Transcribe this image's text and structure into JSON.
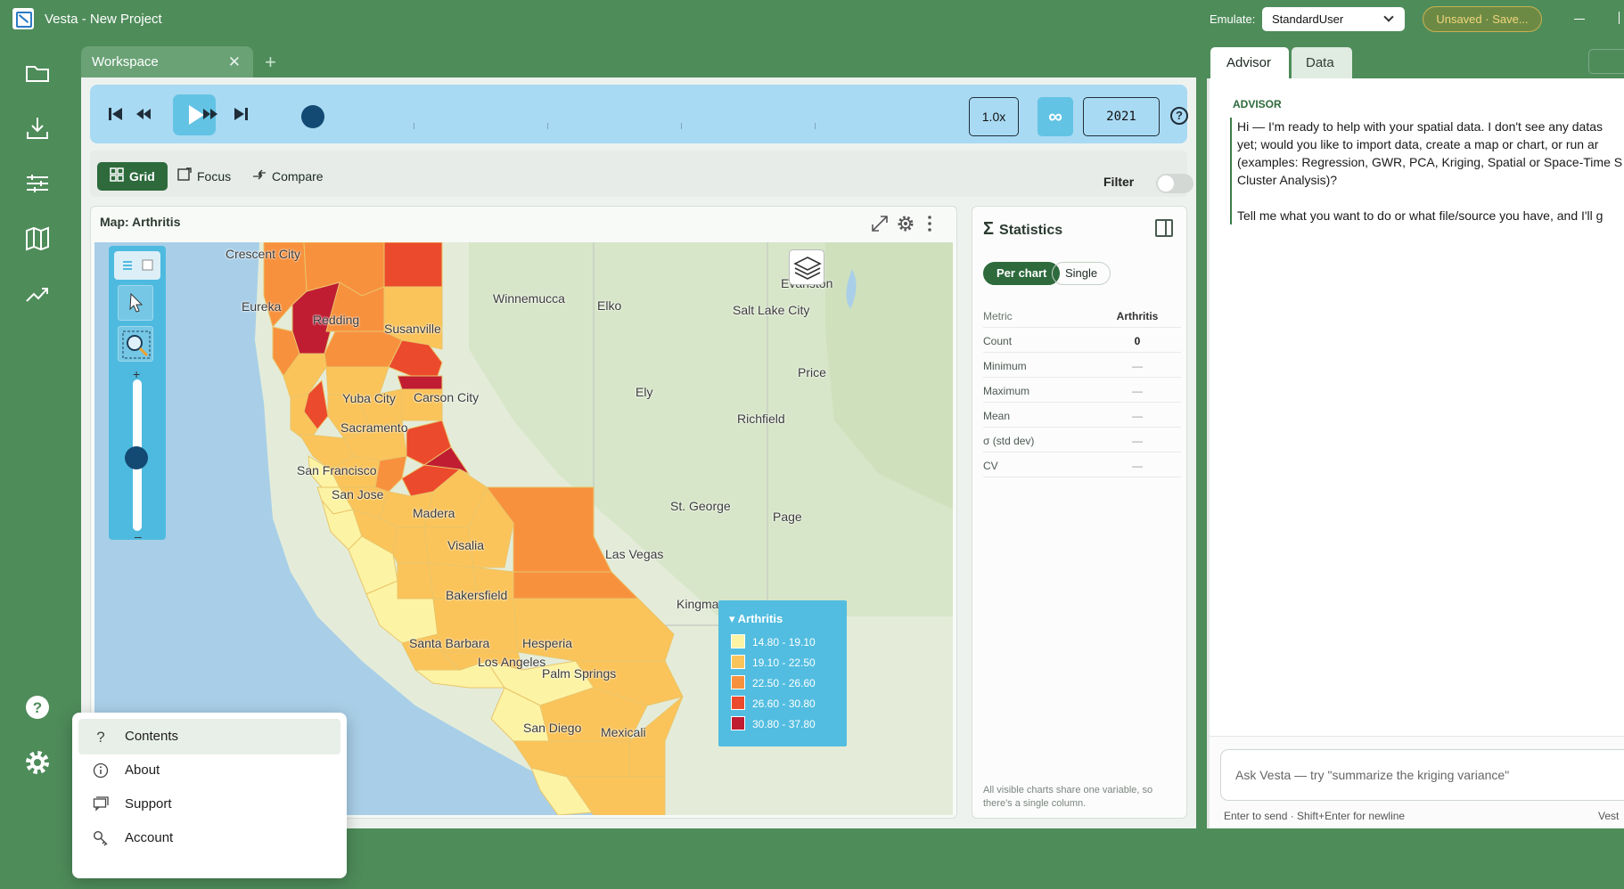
{
  "window": {
    "title": "Vesta - New Project",
    "emulate_label": "Emulate:",
    "emulate_value": "StandardUser",
    "unsaved_label": "Unsaved · Save..."
  },
  "rail": {
    "items": [
      "folder-icon",
      "import-icon",
      "sliders-icon",
      "map-icon",
      "trend-icon"
    ],
    "bottom": [
      "help-icon",
      "settings-icon"
    ]
  },
  "workspace_tab": {
    "label": "Workspace"
  },
  "playbar": {
    "speed": "1.0x",
    "loop_symbol": "∞",
    "year": "2021"
  },
  "viewbar": {
    "grid_label": "Grid",
    "focus_label": "Focus",
    "compare_label": "Compare",
    "filter_label": "Filter"
  },
  "map": {
    "title": "Map: Arthritis",
    "places": [
      "Crescent City",
      "Eureka",
      "Redding",
      "Susanville",
      "Winnemucca",
      "Elko",
      "Salt Lake City",
      "Evanston",
      "Price",
      "Ely",
      "Carson City",
      "Yuba City",
      "Sacramento",
      "Richfield",
      "San Francisco",
      "San Jose",
      "Madera",
      "St. George",
      "Page",
      "Visalia",
      "Las Vegas",
      "Bakersfield",
      "Kingman",
      "Santa Barbara",
      "Hesperia",
      "Los Angeles",
      "Palm Springs",
      "San Diego",
      "Mexicali"
    ],
    "legend": {
      "title": "Arthritis",
      "items": [
        {
          "label": "14.80 - 19.10",
          "color": "#fdf3a4"
        },
        {
          "label": "19.10 - 22.50",
          "color": "#fbc45a"
        },
        {
          "label": "22.50 - 26.60",
          "color": "#f8913e"
        },
        {
          "label": "26.60 - 30.80",
          "color": "#ec4a2c"
        },
        {
          "label": "30.80 - 37.80",
          "color": "#c01d33"
        }
      ]
    }
  },
  "statistics": {
    "title": "Statistics",
    "toggle_per_chart": "Per chart",
    "toggle_single": "Single",
    "column_header": "Arthritis",
    "metric_header": "Metric",
    "rows": [
      {
        "metric": "Count",
        "value": "0"
      },
      {
        "metric": "Minimum",
        "value": "—"
      },
      {
        "metric": "Maximum",
        "value": "—"
      },
      {
        "metric": "Mean",
        "value": "—"
      },
      {
        "metric": "σ (std dev)",
        "value": "—"
      },
      {
        "metric": "CV",
        "value": "—"
      }
    ],
    "footer": "All visible charts share one variable, so there's a single column."
  },
  "advisor": {
    "tabs": [
      "Advisor",
      "Data"
    ],
    "heading": "ADVISOR",
    "message": "Hi — I'm ready to help with your spatial data. I don't see any datas\nyet; would you like to import data, create a map or chart, or run ar\n(examples: Regression, GWR, PCA, Kriging, Spatial or Space-Time S\nCluster Analysis)?\n\nTell me what you want to do or what file/source you have, and I'll g",
    "input_placeholder": "Ask Vesta — try \"summarize the kriging variance\"",
    "hint": "Enter to send · Shift+Enter for newline",
    "hint_right": "Vest"
  },
  "help_menu": {
    "items": [
      {
        "label": "Contents",
        "icon": "question-icon"
      },
      {
        "label": "About",
        "icon": "info-icon"
      },
      {
        "label": "Support",
        "icon": "chat-icon"
      },
      {
        "label": "Account",
        "icon": "key-icon"
      }
    ]
  }
}
